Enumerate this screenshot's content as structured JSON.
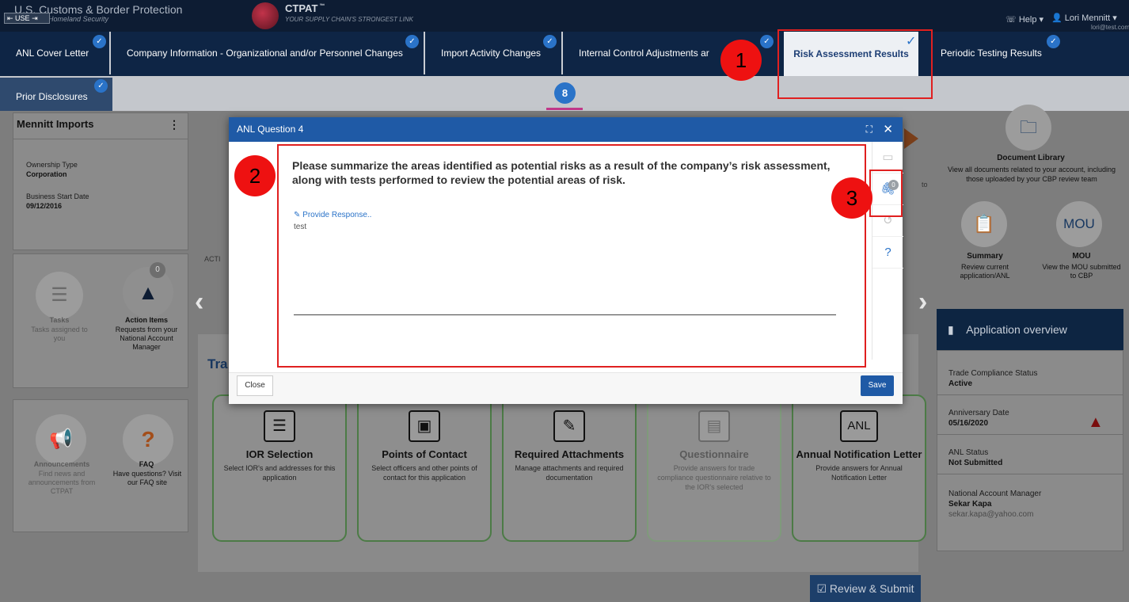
{
  "header": {
    "agency": "U.S. Customs & Border Protection",
    "dept": "ent of Homeland Security",
    "back_label": "USE",
    "product": "CTPAT",
    "tagline": "YOUR SUPPLY CHAIN'S STRONGEST LINK",
    "help": "Help",
    "user": "Lori Mennitt",
    "email": "lori@test.com"
  },
  "tabs": [
    {
      "label": "ANL Cover Letter"
    },
    {
      "label": "Company Information - Organizational and/or Personnel Changes"
    },
    {
      "label": "Import Activity Changes"
    },
    {
      "label": "Internal Control Adjustments ar"
    },
    {
      "label": "Risk Assessment Results"
    },
    {
      "label": "Periodic Testing Results"
    }
  ],
  "sub_tab": "Prior Disclosures",
  "step_number": "8",
  "company": {
    "name": "Mennitt Imports",
    "ownership_label": "Ownership Type",
    "ownership_value": "Corporation",
    "start_label": "Business Start Date",
    "start_value": "09/12/2016"
  },
  "tiles": {
    "tasks_title": "Tasks",
    "tasks_desc": "Tasks assigned to you",
    "action_title": "Action Items",
    "action_desc": "Requests from your National Account Manager",
    "action_count": "0",
    "ann_title": "Announcements",
    "ann_desc": "Find news and announcements from CTPAT",
    "faq_title": "FAQ",
    "faq_desc": "Have questions? Visit our FAQ site"
  },
  "cards": [
    {
      "title": "IOR Selection",
      "desc": "Select IOR's and addresses for this application",
      "icon": "list-numbered-icon"
    },
    {
      "title": "Points of Contact",
      "desc": "Select officers and other points of contact for this application",
      "icon": "contact-card-icon"
    },
    {
      "title": "Required Attachments",
      "desc": "Manage attachments and required documentation",
      "icon": "paperclip-icon"
    },
    {
      "title": "Questionnaire",
      "desc": "Provide answers for trade compliance questionnaire relative to the IOR's selected",
      "icon": "document-icon"
    },
    {
      "title": "Annual Notification Letter",
      "desc": "Provide answers for Annual Notification Letter",
      "icon": "anl-icon"
    }
  ],
  "section_partial": "Tra",
  "bg_partial_act": "ACTI",
  "modal": {
    "title": "ANL Question 4",
    "question": "Please summarize the areas identified as potential risks as a result of the company’s risk assessment, along with tests performed to review the potential areas of risk.",
    "provide_link": "Provide Response..",
    "response": "test",
    "attach_count": "0",
    "close": "Close",
    "save": "Save"
  },
  "right": {
    "doc_title": "Document Library",
    "doc_desc": "View all documents related to your account, including those uploaded by your CBP review team",
    "summary_title": "Summary",
    "summary_desc": "Review current application/ANL",
    "mou_icon": "MOU",
    "mou_title": "MOU",
    "mou_desc": "View the MOU submitted to CBP",
    "overview_title": "Application overview",
    "tc_label": "Trade Compliance Status",
    "tc_value": "Active",
    "ann_label": "Anniversary Date",
    "ann_value": "05/16/2020",
    "anl_label": "ANL Status",
    "anl_value": "Not Submitted",
    "nam_label": "National Account Manager",
    "nam_value": "Sekar Kapa",
    "nam_email": "sekar.kapa@yahoo.com",
    "partial_to": "to"
  },
  "review_btn": "Review & Submit",
  "annotations": [
    "1",
    "2",
    "3"
  ],
  "colors": {
    "accent": "#1f5aa6",
    "annotation": "#ee1111",
    "nav": "#0d1c33"
  }
}
